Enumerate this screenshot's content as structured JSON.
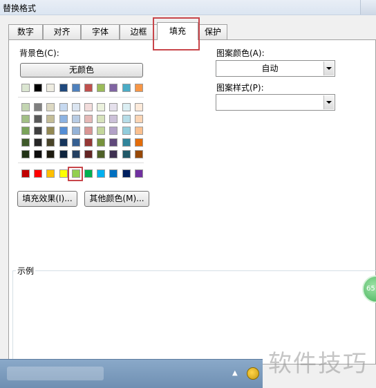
{
  "window": {
    "title": "替换格式"
  },
  "tabs": [
    {
      "label": "数字",
      "active": false
    },
    {
      "label": "对齐",
      "active": false
    },
    {
      "label": "字体",
      "active": false
    },
    {
      "label": "边框",
      "active": false
    },
    {
      "label": "填充",
      "active": true
    },
    {
      "label": "保护",
      "active": false
    }
  ],
  "fill": {
    "bg_label": "背景色(C):",
    "no_color_button": "无颜色",
    "theme_row": [
      "#ffffff",
      "#dbe6d1",
      "#000000",
      "#eeece1",
      "#1f497d",
      "#4f81bd",
      "#c0504d",
      "#9bbb59",
      "#8064a2",
      "#4bacc6",
      "#f79646"
    ],
    "tints": [
      [
        "#f2f2f2",
        "#c3d5b2",
        "#7f7f7f",
        "#ddd9c3",
        "#c6d9f0",
        "#dbe5f1",
        "#f2dcdb",
        "#ebf1dd",
        "#e5e0ec",
        "#dbeef3",
        "#fdeada"
      ],
      [
        "#d8d8d8",
        "#a2bf86",
        "#595959",
        "#c4bd97",
        "#8db3e2",
        "#b8cce4",
        "#e5b9b7",
        "#d7e3bc",
        "#ccc1d9",
        "#b7dde8",
        "#fbd5b5"
      ],
      [
        "#bfbfbf",
        "#7aa35a",
        "#3f3f3f",
        "#938953",
        "#548dd4",
        "#95b3d7",
        "#d99694",
        "#c3d69b",
        "#b2a2c7",
        "#92cddc",
        "#fac08f"
      ],
      [
        "#a5a5a5",
        "#3e5a2a",
        "#262626",
        "#494429",
        "#17365d",
        "#366092",
        "#953734",
        "#76923c",
        "#5f497a",
        "#31859b",
        "#e36c09"
      ],
      [
        "#7f7f7f",
        "#213216",
        "#0c0c0c",
        "#1d1b10",
        "#0f243e",
        "#244061",
        "#632423",
        "#4f6128",
        "#3f3151",
        "#205867",
        "#974806"
      ]
    ],
    "standard_row": [
      "#ffffff",
      "#c00000",
      "#ff0000",
      "#ffc000",
      "#ffff00",
      "#92d050",
      "#00b050",
      "#00b0f0",
      "#0070c0",
      "#002060",
      "#7030a0"
    ],
    "fill_effects_button": "填充效果(I)...",
    "more_colors_button": "其他颜色(M)...",
    "pattern_color_label": "图案颜色(A):",
    "pattern_color_value": "自动",
    "pattern_style_label": "图案样式(P):",
    "pattern_style_value": "",
    "sample_label": "示例"
  },
  "badge": {
    "text": "65"
  },
  "watermark": "软件技巧"
}
